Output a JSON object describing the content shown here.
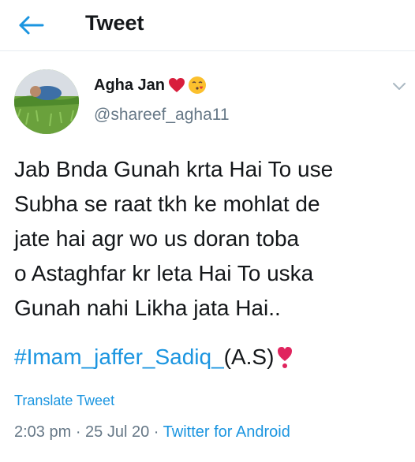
{
  "header": {
    "title": "Tweet"
  },
  "author": {
    "name": "Agha Jan",
    "handle": "@shareef_agha11"
  },
  "tweet": {
    "lines": [
      "Jab Bnda Gunah krta Hai To use",
      "Subha se raat tkh ke mohlat de",
      "jate hai agr wo us doran toba",
      "o Astaghfar kr leta Hai To uska",
      "Gunah nahi Likha jata Hai.."
    ],
    "hashtag": "#Imam_jaffer_Sadiq_",
    "hashtag_suffix": "(A.S)"
  },
  "translate_label": "Translate Tweet",
  "meta": {
    "time": "2:03 pm",
    "date": "25 Jul 20",
    "source": "Twitter for Android"
  },
  "colors": {
    "accent": "#1b95e0",
    "muted": "#657786",
    "text": "#14171a",
    "heart": "#e0245e"
  },
  "icons": [
    "back-arrow-icon",
    "red-heart-emoji",
    "face-blowing-kiss-emoji",
    "chevron-down-icon",
    "heart-exclamation-emoji"
  ]
}
